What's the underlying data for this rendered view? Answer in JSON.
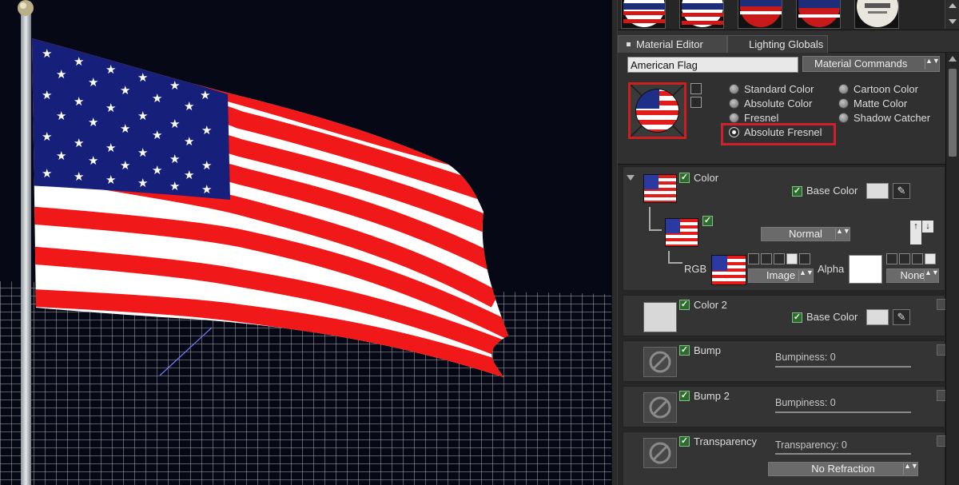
{
  "tabs": [
    {
      "label": "Material Editor",
      "active": true
    },
    {
      "label": "Lighting Globals",
      "active": false
    }
  ],
  "material": {
    "name": "American Flag",
    "commands_label": "Material Commands"
  },
  "shading_types": [
    {
      "label": "Standard Color",
      "selected": false
    },
    {
      "label": "Absolute Color",
      "selected": false
    },
    {
      "label": "Fresnel",
      "selected": false
    },
    {
      "label": "Absolute Fresnel",
      "selected": true
    },
    {
      "label": "Cartoon Color",
      "selected": false
    },
    {
      "label": "Matte Color",
      "selected": false
    },
    {
      "label": "Shadow Catcher",
      "selected": false
    }
  ],
  "layers": {
    "color": {
      "label": "Color",
      "base_color_label": "Base Color",
      "blend_mode": "Normal",
      "rgb_label": "RGB",
      "rgb_mode": "Image",
      "alpha_label": "Alpha",
      "alpha_mode": "None"
    },
    "color2": {
      "label": "Color 2",
      "base_color_label": "Base Color"
    },
    "bump": {
      "label": "Bump",
      "slider_label": "Bumpiness: 0"
    },
    "bump2": {
      "label": "Bump 2",
      "slider_label": "Bumpiness: 0"
    },
    "transparency": {
      "label": "Transparency",
      "slider_label": "Transparency: 0",
      "refraction": "No Refraction"
    }
  },
  "icons": {
    "checkbox": "✓",
    "up_arrow": "↑",
    "down_arrow": "↓",
    "picker": "eyedropper-icon",
    "spin": "▲▼"
  },
  "colors": {
    "flag_red": "#f01818",
    "flag_blue": "#16207a",
    "highlight": "#d1202d",
    "sky": "#060816",
    "grid": "#d8d8d8"
  }
}
